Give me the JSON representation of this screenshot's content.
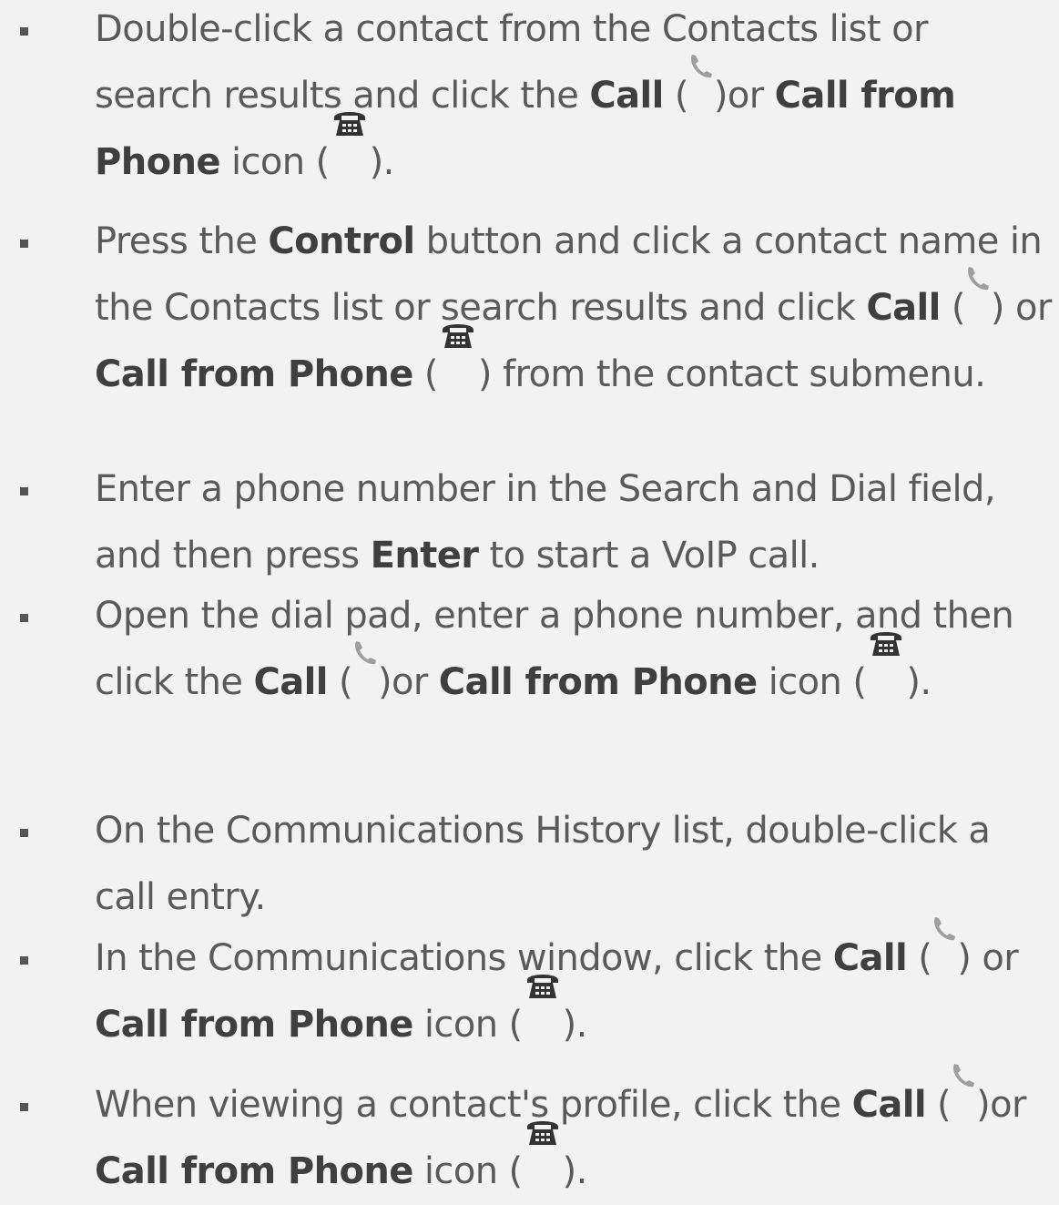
{
  "icons": {
    "call": "handset-icon",
    "call_from_phone": "deskphone-icon"
  },
  "colors": {
    "background": "#f2f2f2",
    "text": "#5a5a5a",
    "bold_text": "#3f3f3f",
    "handset_icon": "#9e9e9e",
    "deskphone_icon": "#333333"
  },
  "items": [
    {
      "parts": [
        {
          "t": "Double-click a contact from the Contacts list or search results and click the "
        },
        {
          "b": "Call"
        },
        {
          "t": " ("
        },
        {
          "t": ")or "
        },
        {
          "b": "Call from Phone"
        },
        {
          "t": " icon ("
        },
        {
          "t": ")."
        }
      ]
    },
    {
      "parts": [
        {
          "t": "Press the "
        },
        {
          "b": "Control"
        },
        {
          "t": " button and click a contact name in the Contacts list or search results and click "
        },
        {
          "b": "Call"
        },
        {
          "t": " ("
        },
        {
          "t": ") or "
        },
        {
          "b": "Call from Phone"
        },
        {
          "t": " ("
        },
        {
          "t": ") from the contact submenu."
        }
      ]
    },
    {
      "parts": [
        {
          "t": "Enter a phone number in the Search and Dial field, and then press "
        },
        {
          "b": "Enter"
        },
        {
          "t": " to start a VoIP call."
        }
      ]
    },
    {
      "parts": [
        {
          "t": "Open the dial pad, enter a phone number, and then click the "
        },
        {
          "b": "Call"
        },
        {
          "t": " ("
        },
        {
          "t": ")or "
        },
        {
          "b": "Call from Phone"
        },
        {
          "t": " icon ("
        },
        {
          "t": ")."
        }
      ]
    },
    {
      "parts": [
        {
          "t": "On the Communications History list, double-click a call entry."
        }
      ]
    },
    {
      "parts": [
        {
          "t": "In the Communications window, click the "
        },
        {
          "b": "Call"
        },
        {
          "t": " ("
        },
        {
          "t": ") or "
        },
        {
          "b": "Call from Phone"
        },
        {
          "t": " icon ("
        },
        {
          "t": ")."
        }
      ]
    },
    {
      "parts": [
        {
          "t": "When viewing a contact's profile, click the "
        },
        {
          "b": "Call"
        },
        {
          "t": " ("
        },
        {
          "t": ")or "
        },
        {
          "b": "Call from Phone"
        },
        {
          "t": " icon ("
        },
        {
          "t": ")."
        }
      ]
    }
  ]
}
